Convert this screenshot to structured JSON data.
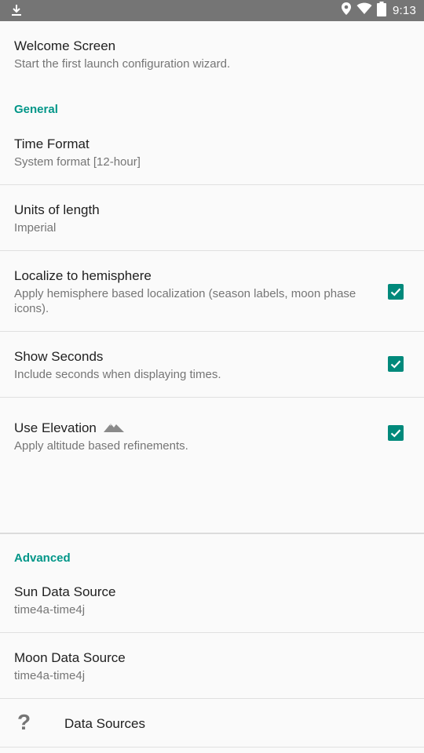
{
  "status_bar": {
    "time": "9:13",
    "left_icon": "download-icon",
    "icons": [
      "location-icon",
      "wifi-icon",
      "battery-icon"
    ]
  },
  "prefs": {
    "welcome": {
      "title": "Welcome Screen",
      "summary": "Start the first launch configuration wizard."
    },
    "general_header": "General",
    "time_format": {
      "title": "Time Format",
      "summary": "System format [12-hour]"
    },
    "units": {
      "title": "Units of length",
      "summary": "Imperial"
    },
    "hemisphere": {
      "title": "Localize to hemisphere",
      "summary": "Apply hemisphere based localization (season labels, moon phase icons).",
      "checked": true
    },
    "seconds": {
      "title": "Show Seconds",
      "summary": "Include seconds when displaying times.",
      "checked": true
    },
    "elevation": {
      "title": "Use Elevation",
      "summary": "Apply altitude based refinements.",
      "checked": true,
      "icon": "mountain-icon"
    },
    "advanced_header": "Advanced",
    "sun_source": {
      "title": "Sun Data Source",
      "summary": "time4a-time4j"
    },
    "moon_source": {
      "title": "Moon Data Source",
      "summary": "time4a-time4j"
    },
    "data_sources": {
      "title": "Data Sources",
      "icon": "help-icon",
      "icon_glyph": "?"
    }
  },
  "colors": {
    "accent": "#009688",
    "checkbox": "#00897b",
    "status_bar": "#757575"
  }
}
